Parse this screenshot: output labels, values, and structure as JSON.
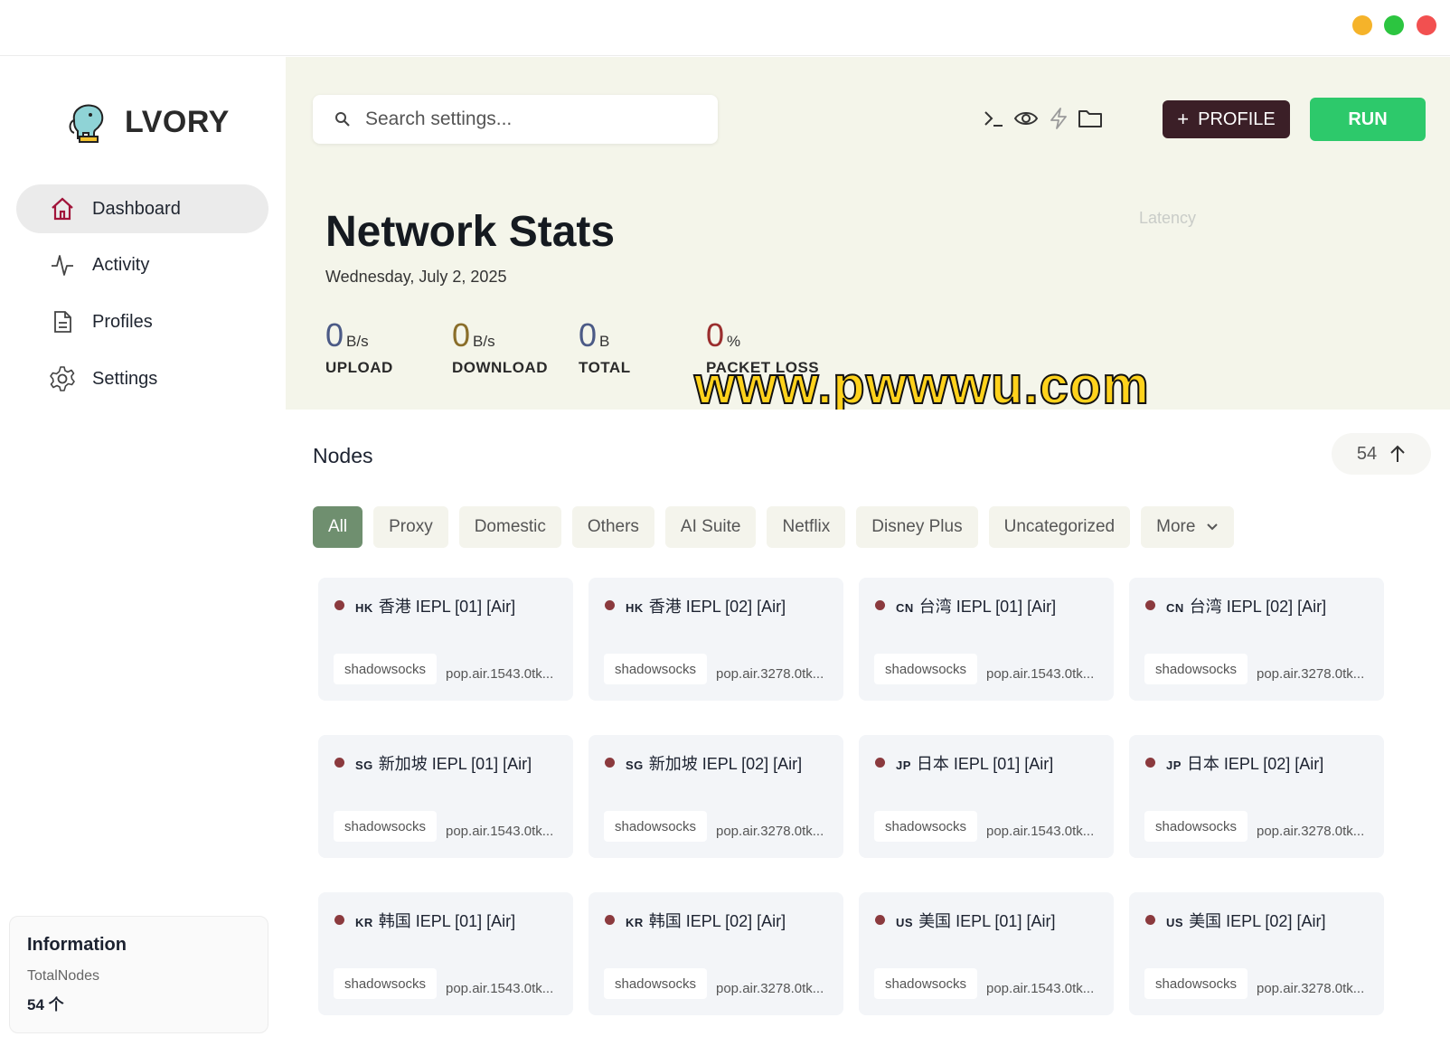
{
  "app": {
    "name": "LVORY"
  },
  "sidebar": {
    "items": [
      {
        "label": "Dashboard",
        "icon": "home-icon"
      },
      {
        "label": "Activity",
        "icon": "activity-icon"
      },
      {
        "label": "Profiles",
        "icon": "document-icon"
      },
      {
        "label": "Settings",
        "icon": "gear-icon"
      }
    ],
    "info": {
      "title": "Information",
      "label": "TotalNodes",
      "value": "54 个"
    }
  },
  "header": {
    "search_placeholder": "Search settings...",
    "profile_label": "PROFILE",
    "run_label": "RUN",
    "tools": [
      "terminal-icon",
      "eye-icon",
      "bolt-icon",
      "folder-icon"
    ]
  },
  "stats": {
    "title": "Network Stats",
    "date": "Wednesday, July 2, 2025",
    "latency_label": "Latency",
    "items": [
      {
        "value": "0",
        "unit": "B/s",
        "label": "UPLOAD",
        "color": "#4b5a86"
      },
      {
        "value": "0",
        "unit": "B/s",
        "label": "DOWNLOAD",
        "color": "#8a6e2a"
      },
      {
        "value": "0",
        "unit": "B",
        "label": "TOTAL",
        "color": "#4b5a86"
      },
      {
        "value": "0",
        "unit": "%",
        "label": "PACKET LOSS",
        "color": "#9a2e2e"
      }
    ]
  },
  "watermark": "www.pwwwu.com",
  "nodes": {
    "title": "Nodes",
    "count": "54",
    "tabs": [
      "All",
      "Proxy",
      "Domestic",
      "Others",
      "AI Suite",
      "Netflix",
      "Disney Plus",
      "Uncategorized",
      "More"
    ],
    "cards": [
      {
        "cc": "HK",
        "name": "香港 IEPL [01] [Air]",
        "type": "shadowsocks",
        "host": "pop.air.1543.0tk..."
      },
      {
        "cc": "HK",
        "name": "香港 IEPL [02] [Air]",
        "type": "shadowsocks",
        "host": "pop.air.3278.0tk..."
      },
      {
        "cc": "CN",
        "name": "台湾 IEPL [01] [Air]",
        "type": "shadowsocks",
        "host": "pop.air.1543.0tk..."
      },
      {
        "cc": "CN",
        "name": "台湾 IEPL [02] [Air]",
        "type": "shadowsocks",
        "host": "pop.air.3278.0tk..."
      },
      {
        "cc": "SG",
        "name": "新加坡 IEPL [01] [Air]",
        "type": "shadowsocks",
        "host": "pop.air.1543.0tk..."
      },
      {
        "cc": "SG",
        "name": "新加坡 IEPL [02] [Air]",
        "type": "shadowsocks",
        "host": "pop.air.3278.0tk..."
      },
      {
        "cc": "JP",
        "name": "日本 IEPL [01] [Air]",
        "type": "shadowsocks",
        "host": "pop.air.1543.0tk..."
      },
      {
        "cc": "JP",
        "name": "日本 IEPL [02] [Air]",
        "type": "shadowsocks",
        "host": "pop.air.3278.0tk..."
      },
      {
        "cc": "KR",
        "name": "韩国 IEPL [01] [Air]",
        "type": "shadowsocks",
        "host": "pop.air.1543.0tk..."
      },
      {
        "cc": "KR",
        "name": "韩国 IEPL [02] [Air]",
        "type": "shadowsocks",
        "host": "pop.air.3278.0tk..."
      },
      {
        "cc": "US",
        "name": "美国 IEPL [01] [Air]",
        "type": "shadowsocks",
        "host": "pop.air.1543.0tk..."
      },
      {
        "cc": "US",
        "name": "美国 IEPL [02] [Air]",
        "type": "shadowsocks",
        "host": "pop.air.3278.0tk..."
      }
    ]
  },
  "colors": {
    "accent_green": "#2dc96b",
    "profile_button": "#3b1f27",
    "active_tab": "#6f8f6f",
    "status_dot": "#8b3a3e",
    "hero_bg": "#f4f5ea"
  }
}
